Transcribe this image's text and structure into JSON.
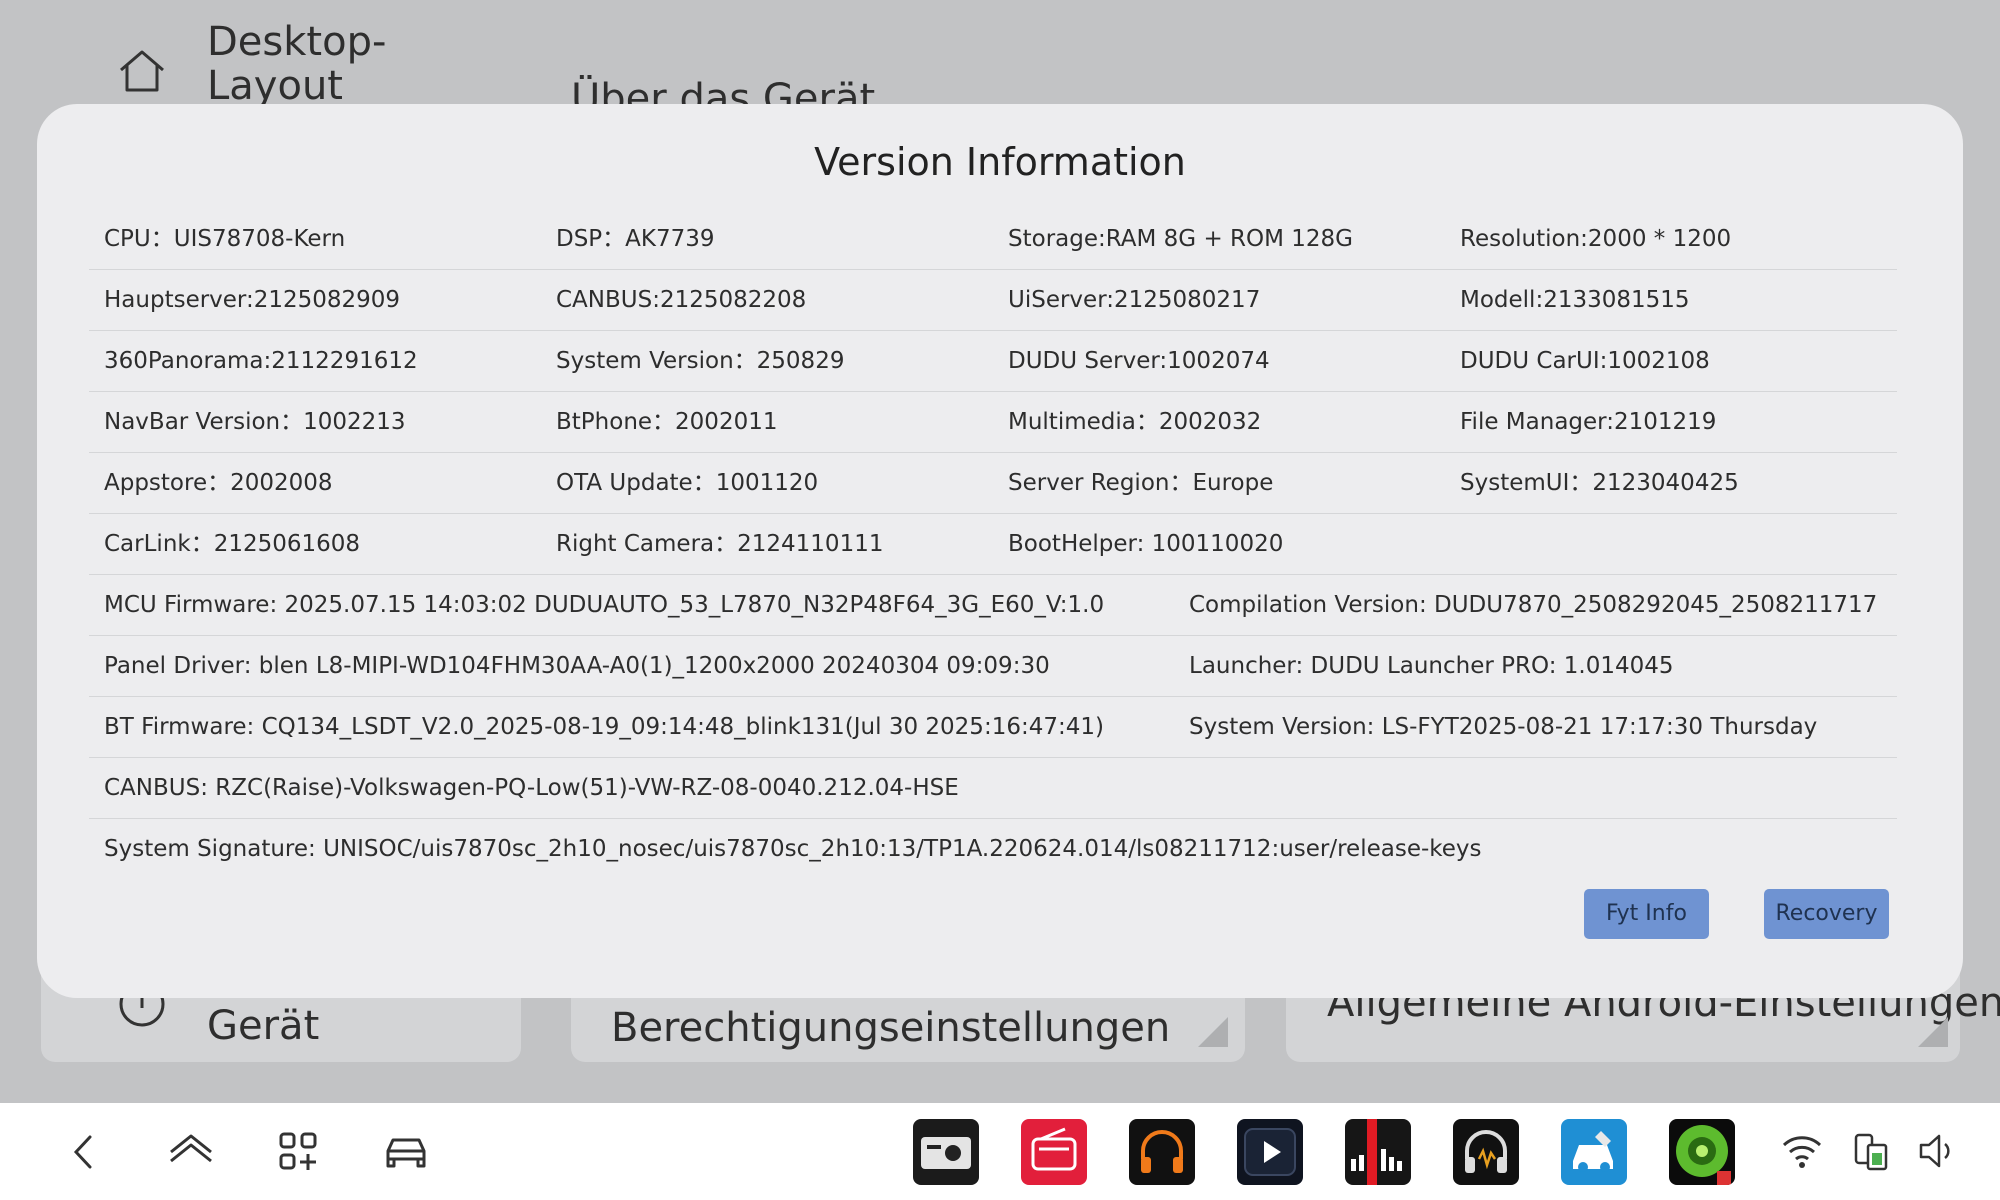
{
  "background": {
    "sidebar_item_label": "Desktop-Layout",
    "header_title": "Über das Gerät",
    "cards": [
      "Gerät",
      "Berechtigungseinstellungen",
      "Allgemeine Android-Einstellungen"
    ]
  },
  "dialog": {
    "title": "Version Information",
    "rows": [
      [
        "CPU：UIS78708-Kern",
        "DSP：AK7739",
        "Storage:RAM 8G + ROM 128G",
        "Resolution:2000 * 1200"
      ],
      [
        "Hauptserver:2125082909",
        "CANBUS:2125082208",
        "UiServer:2125080217",
        "Modell:2133081515"
      ],
      [
        "360Panorama:2112291612",
        "System Version：250829",
        "DUDU Server:1002074",
        "DUDU CarUI:1002108"
      ],
      [
        "NavBar Version：1002213",
        "BtPhone：2002011",
        "Multimedia：2002032",
        "File Manager:2101219"
      ],
      [
        "Appstore：2002008",
        "OTA Update：1001120",
        "Server Region：Europe",
        "SystemUI：2123040425"
      ],
      [
        "CarLink：2125061608",
        "Right Camera：2124110111",
        "BootHelper: 100110020",
        ""
      ]
    ],
    "wide_rows": [
      [
        "MCU Firmware:  2025.07.15 14:03:02 DUDUAUTO_53_L7870_N32P48F64_3G_E60_V:1.0",
        "Compilation Version:  DUDU7870_2508292045_2508211717"
      ],
      [
        "Panel Driver:  blen L8-MIPI-WD104FHM30AA-A0(1)_1200x2000 20240304 09:09:30",
        "Launcher:  DUDU Launcher PRO: 1.014045"
      ],
      [
        "BT Firmware:  CQ134_LSDT_V2.0_2025-08-19_09:14:48_blink131(Jul 30 2025:16:47:41)",
        "System Version:  LS-FYT2025-08-21 17:17:30 Thursday"
      ],
      [
        "CANBUS:  RZC(Raise)-Volkswagen-PQ-Low(51)-VW-RZ-08-0040.212.04-HSE",
        ""
      ],
      [
        "System Signature:  UNISOC/uis7870sc_2h10_nosec/uis7870sc_2h10:13/TP1A.220624.014/ls08211712:user/release-keys",
        ""
      ]
    ],
    "buttons": {
      "fyt_info": "Fyt Info",
      "recovery": "Recovery"
    }
  },
  "navbar": {
    "nav_icons": [
      "back-icon",
      "home-icon",
      "apps-icon",
      "car-icon"
    ],
    "apps": [
      "radio-app",
      "fm-radio-app",
      "headphones-app",
      "video-player-app",
      "equalizer-app",
      "audio-app",
      "car-service-app",
      "level-pro-app"
    ],
    "status_icons": [
      "wifi-icon",
      "phone-battery-icon",
      "volume-icon"
    ]
  },
  "colors": {
    "accent": "#6f93d2",
    "dialog_bg": "#ededef",
    "screen_bg": "#c2c3c5"
  }
}
